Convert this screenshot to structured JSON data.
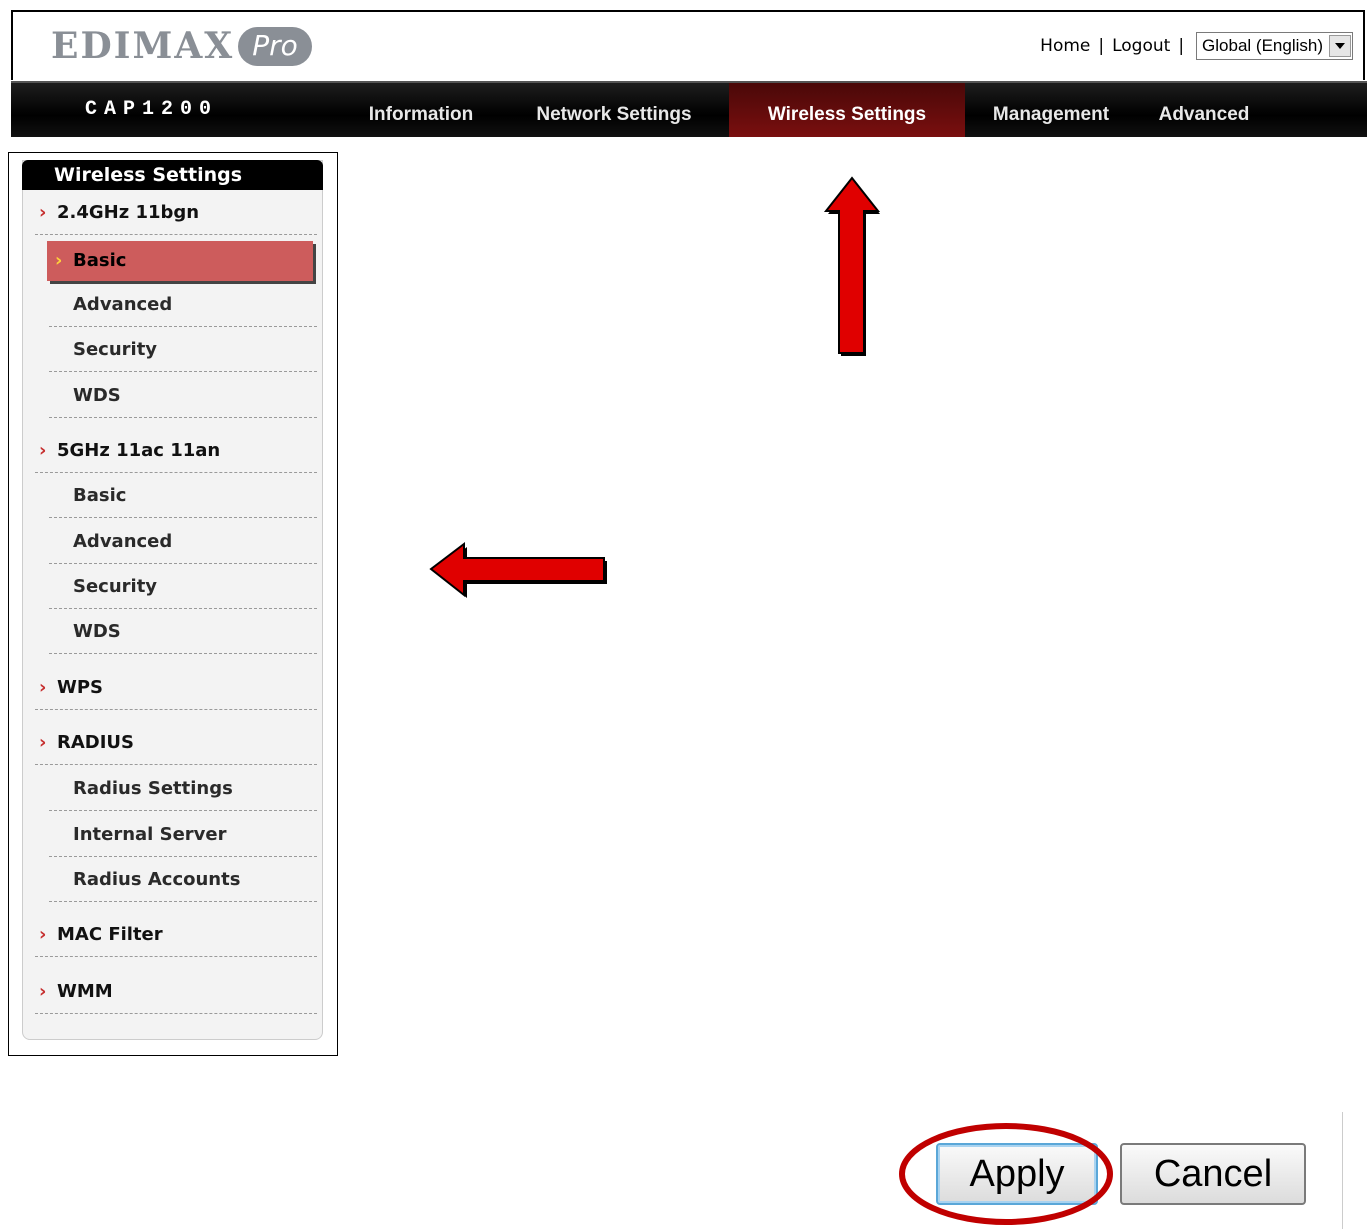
{
  "header": {
    "logo_text": "EDIMAX",
    "logo_badge": "Pro",
    "links": {
      "home": "Home",
      "logout": "Logout",
      "separator": "|"
    },
    "language": {
      "selected": "Global (English)"
    }
  },
  "navbar": {
    "model": "CAP1200",
    "tabs": [
      {
        "label": "Information"
      },
      {
        "label": "Network Settings"
      },
      {
        "label": "Wireless Settings",
        "active": true
      },
      {
        "label": "Management"
      },
      {
        "label": "Advanced"
      }
    ]
  },
  "sidebar": {
    "title": "Wireless Settings",
    "groups": {
      "g24": {
        "label": "2.4GHz 11bgn",
        "items": [
          "Basic",
          "Advanced",
          "Security",
          "WDS"
        ]
      },
      "g5": {
        "label": "5GHz 11ac 11an",
        "items": [
          "Basic",
          "Advanced",
          "Security",
          "WDS"
        ]
      },
      "wps": {
        "label": "WPS"
      },
      "radius": {
        "label": "RADIUS",
        "items": [
          "Radius Settings",
          "Internal Server",
          "Radius Accounts"
        ]
      },
      "mac": {
        "label": "MAC Filter"
      },
      "wmm": {
        "label": "WMM"
      }
    },
    "chevron": "›"
  },
  "buttons": {
    "apply": "Apply",
    "cancel": "Cancel"
  },
  "colors": {
    "accent_red": "#cd5c5c",
    "nav_active": "#7a0f0f",
    "annotation_red": "#e00000",
    "ring": "#c00000"
  }
}
